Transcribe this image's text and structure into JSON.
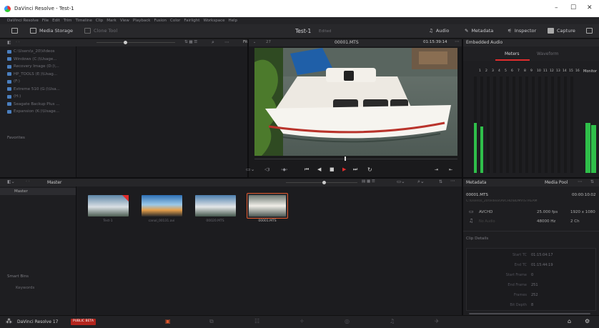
{
  "window": {
    "title": "DaVinci Resolve - Test-1",
    "controls": [
      "–",
      "☐",
      "✕"
    ]
  },
  "menu": [
    "DaVinci Resolve",
    "File",
    "Edit",
    "Trim",
    "Timeline",
    "Clip",
    "Mark",
    "View",
    "Playback",
    "Fusion",
    "Color",
    "Fairlight",
    "Workspace",
    "Help"
  ],
  "toolbar": {
    "media_storage": "Media Storage",
    "clone_tool": "Clone Tool",
    "project_name": "Test-1",
    "project_status": "Edited",
    "audio": "Audio",
    "metadata": "Metadata",
    "inspector": "Inspector",
    "capture": "Capture"
  },
  "storage": {
    "volumes": [
      "C:\\Users\\s_20\\Videos",
      "Windows (C:)\\Usage...",
      "Recovery Image (D:)\\...",
      "HP_TOOLS (E:)\\Usag...",
      "(F:)",
      "Extreme 510 (G:)\\Usa...",
      "(H:)",
      "Seagate Backup Plus ...",
      "Expansion (K:)\\Usage..."
    ],
    "favorites": "Favorites"
  },
  "viewer": {
    "fit": "Fit",
    "zoom": "27",
    "clip_name": "00001.MTS",
    "timecode": "01:15:39:14"
  },
  "audio_panel": {
    "title": "Embedded Audio",
    "tab_meters": "Meters",
    "tab_waveform": "Waveform",
    "channels": [
      "1",
      "2",
      "3",
      "4",
      "5",
      "6",
      "7",
      "8",
      "9",
      "10",
      "11",
      "12",
      "13",
      "14",
      "15",
      "16"
    ],
    "monitor": "Monitor",
    "levels": [
      0.52,
      0.48,
      0.0,
      0.0,
      0.0,
      0.0,
      0.0,
      0.0,
      0.0,
      0.0,
      0.0,
      0.0,
      0.0,
      0.0,
      0.0,
      0.0
    ],
    "monitor_levels": [
      0.52,
      0.5
    ]
  },
  "media_pool": {
    "bin": "Master",
    "tree_master": "Master",
    "smart_bins": "Smart Bins",
    "keywords": "Keywords",
    "clips": [
      "Test-1",
      "canal_00131.avi",
      "00020.MTS",
      "00001.MTS"
    ]
  },
  "metadata": {
    "title": "Metadata",
    "media_pool_label": "Media Pool",
    "clip_name": "00001.MTS",
    "clip_duration": "00:00:10:02",
    "clip_path": "C:\\Users\\s_20\\Videos\\AVCHD\\BDMV\\STREAM",
    "codec": "AVCHD",
    "fps": "25.000 fps",
    "resolution": "1920 x 1080",
    "audio_codec": "No Audio",
    "sample_rate": "48000 Hz",
    "audio_ch": "2 Ch",
    "clip_details_title": "Clip Details",
    "details": [
      {
        "label": "Start TC",
        "value": "01:15:04:17"
      },
      {
        "label": "End TC",
        "value": "01:15:44:19"
      },
      {
        "label": "Start Frame",
        "value": "0"
      },
      {
        "label": "End Frame",
        "value": "251"
      },
      {
        "label": "Frames",
        "value": "252"
      },
      {
        "label": "Bit Depth",
        "value": "8"
      }
    ]
  },
  "bottom": {
    "app": "DaVinci Resolve 17",
    "beta": "PUBLIC BETA"
  }
}
